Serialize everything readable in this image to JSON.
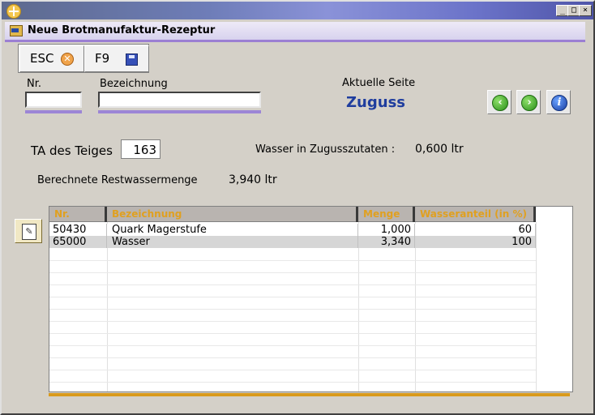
{
  "window": {
    "title": "",
    "minimize_glyph": "_",
    "maximize_glyph": "□",
    "close_glyph": "×"
  },
  "form": {
    "title": "Neue Brotmanufaktur-Rezeptur"
  },
  "toolbar": {
    "esc_label": "ESC",
    "esc_icon": "cancel-icon",
    "f9_label": "F9",
    "f9_icon": "save-disk-icon"
  },
  "fields": {
    "nr_label": "Nr.",
    "nr_value": "",
    "bezeichnung_label": "Bezeichnung",
    "bezeichnung_value": ""
  },
  "page": {
    "label": "Aktuelle Seite",
    "current": "Zuguss"
  },
  "nav": {
    "back_icon": "arrow-left-icon",
    "forward_icon": "arrow-right-icon",
    "info_icon": "info-icon",
    "back_glyph": "‹",
    "forward_glyph": "›",
    "info_glyph": "i"
  },
  "dough": {
    "ta_label": "TA des Teiges",
    "ta_value": "163",
    "water_label": "Wasser in Zugusszutaten :",
    "water_value": "0,600 ltr",
    "rest_label": "Berechnete Restwassermenge",
    "rest_value": "3,940 ltr"
  },
  "table": {
    "columns": [
      "Nr.",
      "Bezeichnung",
      "Menge",
      "Wasseranteil (in %)"
    ],
    "rows": [
      {
        "nr": "50430",
        "bezeichnung": "Quark Magerstufe",
        "menge": "1,000",
        "wasseranteil": "60"
      },
      {
        "nr": "65000",
        "bezeichnung": "Wasser",
        "menge": "3,340",
        "wasseranteil": "100"
      }
    ]
  },
  "colors": {
    "accent": "#9c85d6",
    "page_title": "#1f3d9e",
    "header_text": "#e0a020",
    "footer_bar": "#d99a1c"
  }
}
